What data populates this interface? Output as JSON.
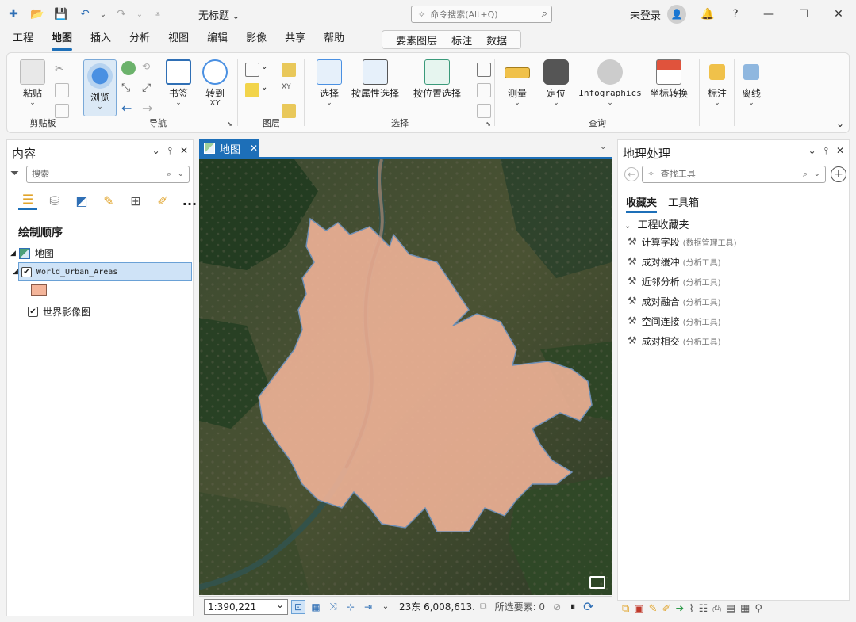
{
  "app": {
    "title": "无标题",
    "command_search_placeholder": "命令搜索(Alt+Q)",
    "user_status": "未登录",
    "help": "?"
  },
  "menu": {
    "tabs": [
      "工程",
      "地图",
      "插入",
      "分析",
      "视图",
      "编辑",
      "影像",
      "共享",
      "帮助"
    ],
    "active_tab": "地图",
    "context_tabs": [
      "要素图层",
      "标注",
      "数据"
    ]
  },
  "ribbon": {
    "clipboard": {
      "label": "剪贴板",
      "paste": "粘贴"
    },
    "navigate": {
      "label": "导航",
      "explore": "浏览",
      "bookmarks": "书签",
      "goto": "转到",
      "goto_sub": "XY"
    },
    "layer": {
      "label": "图层"
    },
    "selection": {
      "label": "选择",
      "select": "选择",
      "by_attr": "按属性选择",
      "by_loc": "按位置选择"
    },
    "inquiry": {
      "label": "查询",
      "measure": "测量",
      "locate": "定位",
      "infographics": "Infographics",
      "coord": "坐标转换"
    },
    "labeling": {
      "label": "标注"
    },
    "offline": {
      "label": "离线"
    }
  },
  "contents": {
    "title": "内容",
    "search_placeholder": "搜索",
    "section": "绘制顺序",
    "map_name": "地图",
    "layer_name": "World_Urban_Areas",
    "basemap_name": "世界影像图",
    "more": "..."
  },
  "map_view": {
    "tab": "地图",
    "scale": "1:390,221",
    "coords": "23东 6,008,613.",
    "selected_label": "所选要素: 0"
  },
  "geoprocessing": {
    "title": "地理处理",
    "search_placeholder": "查找工具",
    "tabs": [
      "收藏夹",
      "工具箱"
    ],
    "favorites_header": "工程收藏夹",
    "tools": [
      {
        "name": "计算字段",
        "box": "(数据管理工具)"
      },
      {
        "name": "成对缓冲",
        "box": "(分析工具)"
      },
      {
        "name": "近邻分析",
        "box": "(分析工具)"
      },
      {
        "name": "成对融合",
        "box": "(分析工具)"
      },
      {
        "name": "空间连接",
        "box": "(分析工具)"
      },
      {
        "name": "成对相交",
        "box": "(分析工具)"
      }
    ]
  },
  "colors": {
    "accent": "#1d6fb8",
    "urban_fill": "#f4b59a",
    "urban_outline": "#6e8fb5"
  }
}
